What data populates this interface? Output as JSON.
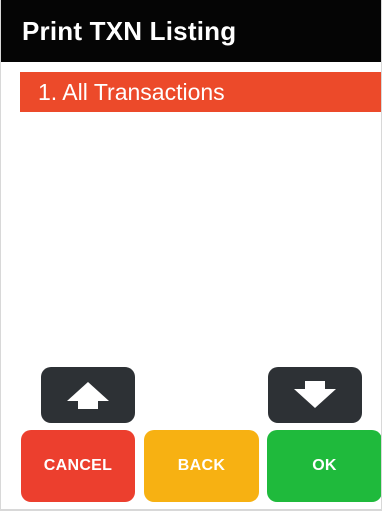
{
  "header": {
    "title": "Print TXN Listing"
  },
  "menu": {
    "items": [
      {
        "label": "1. All Transactions",
        "selected": true
      }
    ]
  },
  "navigation": {
    "up_icon": "arrow-up-icon",
    "down_icon": "arrow-down-icon"
  },
  "actions": {
    "cancel_label": "CANCEL",
    "back_label": "BACK",
    "ok_label": "OK"
  },
  "colors": {
    "header": "#050505",
    "selected_item": "#ec4a2a",
    "navigation_button": "#2d3135",
    "cancel": "#ec3f2e",
    "back": "#f7b112",
    "ok": "#1fba3c"
  }
}
